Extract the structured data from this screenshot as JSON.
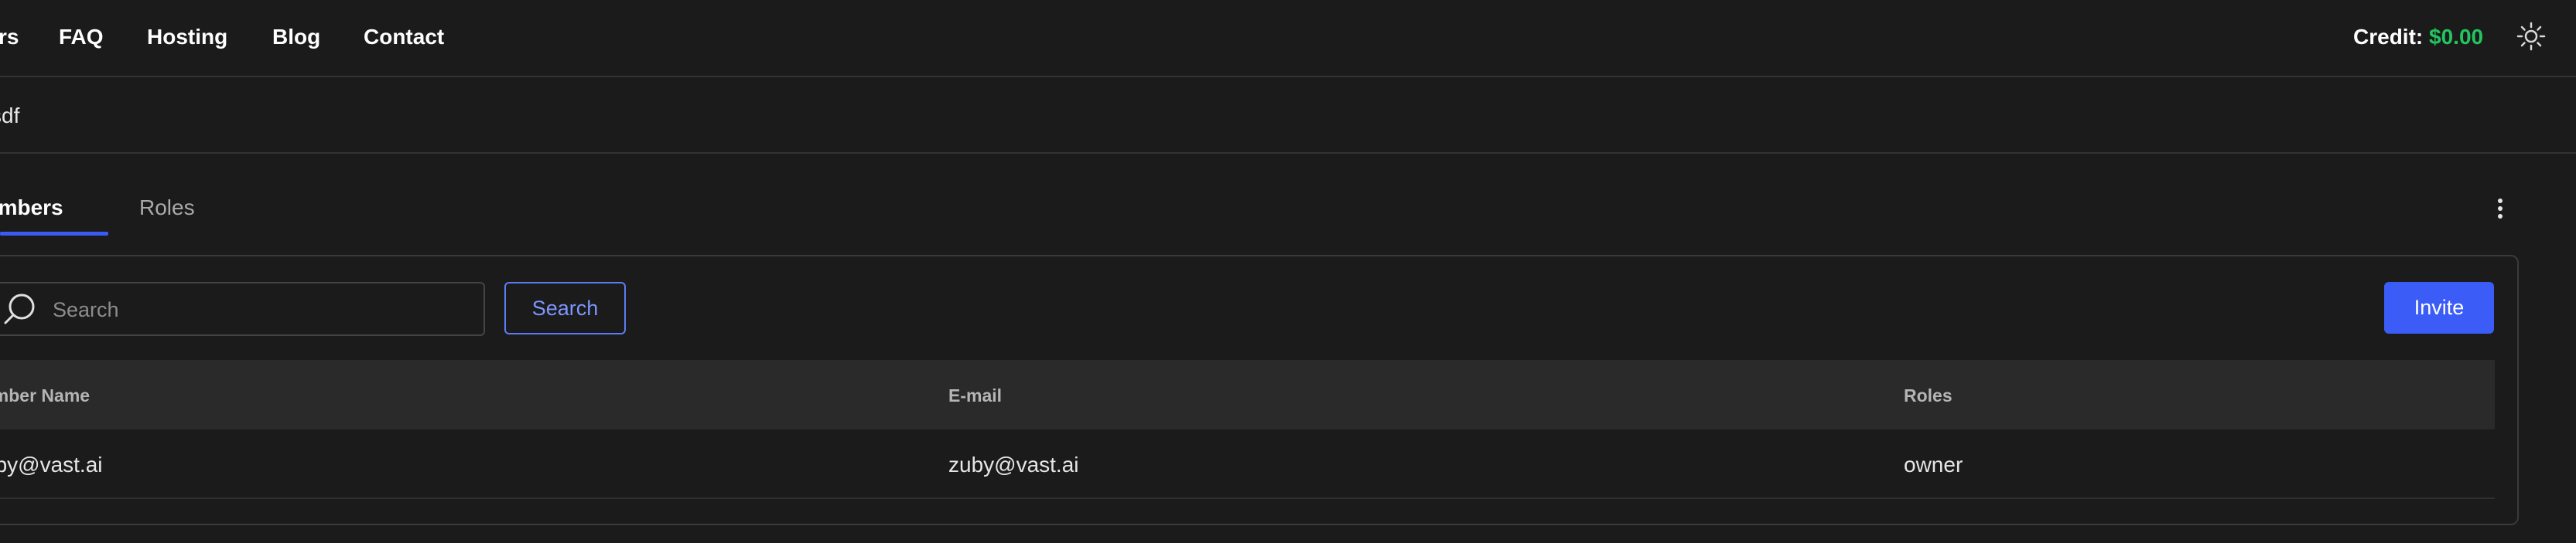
{
  "nav": {
    "items": [
      {
        "label": "rs"
      },
      {
        "label": "FAQ"
      },
      {
        "label": "Hosting"
      },
      {
        "label": "Blog"
      },
      {
        "label": "Contact"
      }
    ],
    "credit_label": "Credit:",
    "credit_amount": "$0.00",
    "theme_icon": "sun-icon"
  },
  "team": {
    "name": "sdf"
  },
  "tabs": [
    {
      "label": "embers",
      "active": true
    },
    {
      "label": "Roles",
      "active": false
    }
  ],
  "toolbar": {
    "search_placeholder": "Search",
    "search_value": "",
    "search_button": "Search",
    "invite_button": "Invite"
  },
  "table": {
    "columns": [
      "ember Name",
      "E-mail",
      "Roles"
    ],
    "rows": [
      {
        "name": "uby@vast.ai",
        "email": "zuby@vast.ai",
        "role": "owner"
      }
    ]
  },
  "colors": {
    "accent": "#3b5cf7",
    "credit": "#22c55e",
    "background": "#1b1b1b"
  }
}
